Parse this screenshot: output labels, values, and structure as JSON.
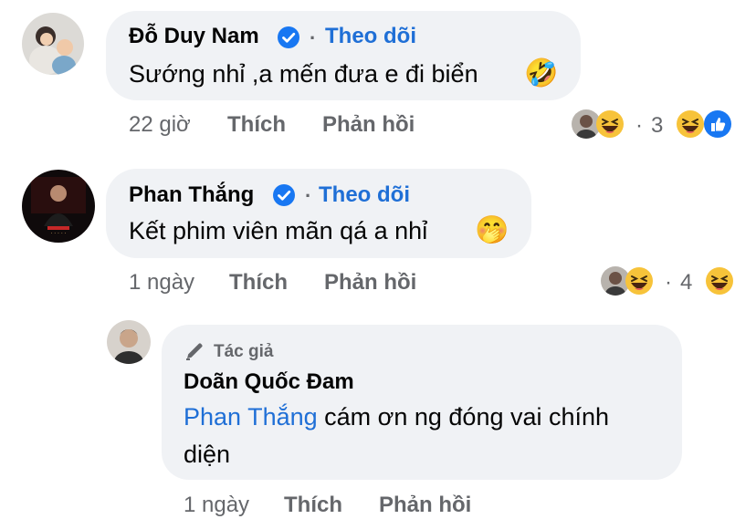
{
  "comments": [
    {
      "author": "Đỗ Duy Nam",
      "follow_label": "Theo dõi",
      "separator": "·",
      "text": "Sướng nhỉ ,a mến đưa e đi biển",
      "text_emoji": "🤣",
      "time": "22 giờ",
      "like_label": "Thích",
      "reply_label": "Phản hồi",
      "reactions": {
        "dot": "·",
        "count": "3"
      }
    },
    {
      "author": "Phan Thắng",
      "follow_label": "Theo dõi",
      "separator": "·",
      "text": "Kết phim viên mãn qá a nhỉ",
      "text_emoji": "🤭",
      "time": "1 ngày",
      "like_label": "Thích",
      "reply_label": "Phản hồi",
      "reactions": {
        "dot": "·",
        "count": "4"
      }
    }
  ],
  "reply": {
    "author_badge": "Tác giả",
    "author": "Doãn Quốc Đam",
    "mention": "Phan Thắng",
    "text_line1": " cám ơn ng đóng vai chính",
    "text_line2": "diện",
    "time": "1 ngày",
    "like_label": "Thích",
    "reply_label": "Phản hồi"
  },
  "colors": {
    "bubble": "#f0f2f5",
    "link_blue": "#1f6fd6",
    "meta_gray": "#65676b",
    "verified_blue": "#1877f2"
  }
}
